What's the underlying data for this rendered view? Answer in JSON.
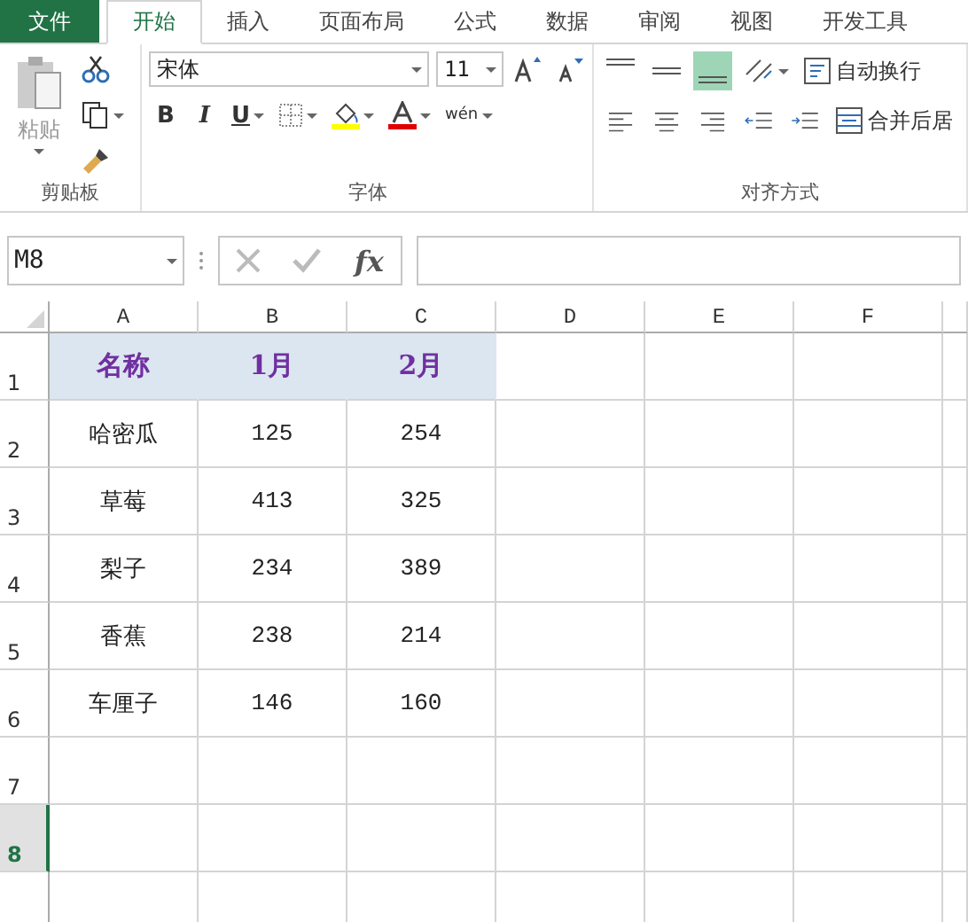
{
  "tabs": [
    {
      "label": "文件",
      "kind": "file",
      "selected": false
    },
    {
      "label": "开始",
      "kind": "tab",
      "selected": true
    },
    {
      "label": "插入",
      "kind": "tab",
      "selected": false
    },
    {
      "label": "页面布局",
      "kind": "tab",
      "selected": false
    },
    {
      "label": "公式",
      "kind": "tab",
      "selected": false
    },
    {
      "label": "数据",
      "kind": "tab",
      "selected": false
    },
    {
      "label": "审阅",
      "kind": "tab",
      "selected": false
    },
    {
      "label": "视图",
      "kind": "tab",
      "selected": false
    },
    {
      "label": "开发工具",
      "kind": "tab",
      "selected": false
    }
  ],
  "ribbon": {
    "clipboard": {
      "label": "剪贴板",
      "paste": "粘贴"
    },
    "font": {
      "label": "字体",
      "font_name": "宋体",
      "font_size": "11",
      "bold": "B",
      "italic": "I",
      "underline": "U",
      "phonetic": "wén"
    },
    "alignment": {
      "label": "对齐方式",
      "align_buttons": [
        {
          "kind": "top",
          "selected": false
        },
        {
          "kind": "middle",
          "selected": false
        },
        {
          "kind": "bottom",
          "selected": true
        }
      ],
      "wrap_text": "自动换行",
      "merge_center": "合并后居"
    }
  },
  "formula_bar": {
    "name_box": "M8",
    "fx": "fx"
  },
  "sheet": {
    "columns": [
      "A",
      "B",
      "C",
      "D",
      "E",
      "F"
    ],
    "rows": [
      {
        "number": "1",
        "selected": false,
        "header": true,
        "cells": [
          "名称",
          "1月",
          "2月"
        ]
      },
      {
        "number": "2",
        "selected": false,
        "header": false,
        "cells": [
          "哈密瓜",
          "125",
          "254"
        ]
      },
      {
        "number": "3",
        "selected": false,
        "header": false,
        "cells": [
          "草莓",
          "413",
          "325"
        ]
      },
      {
        "number": "4",
        "selected": false,
        "header": false,
        "cells": [
          "梨子",
          "234",
          "389"
        ]
      },
      {
        "number": "5",
        "selected": false,
        "header": false,
        "cells": [
          "香蕉",
          "238",
          "214"
        ]
      },
      {
        "number": "6",
        "selected": false,
        "header": false,
        "cells": [
          "车厘子",
          "146",
          "160"
        ]
      },
      {
        "number": "7",
        "selected": false,
        "header": false,
        "cells": []
      },
      {
        "number": "8",
        "selected": true,
        "header": false,
        "cells": []
      }
    ]
  }
}
